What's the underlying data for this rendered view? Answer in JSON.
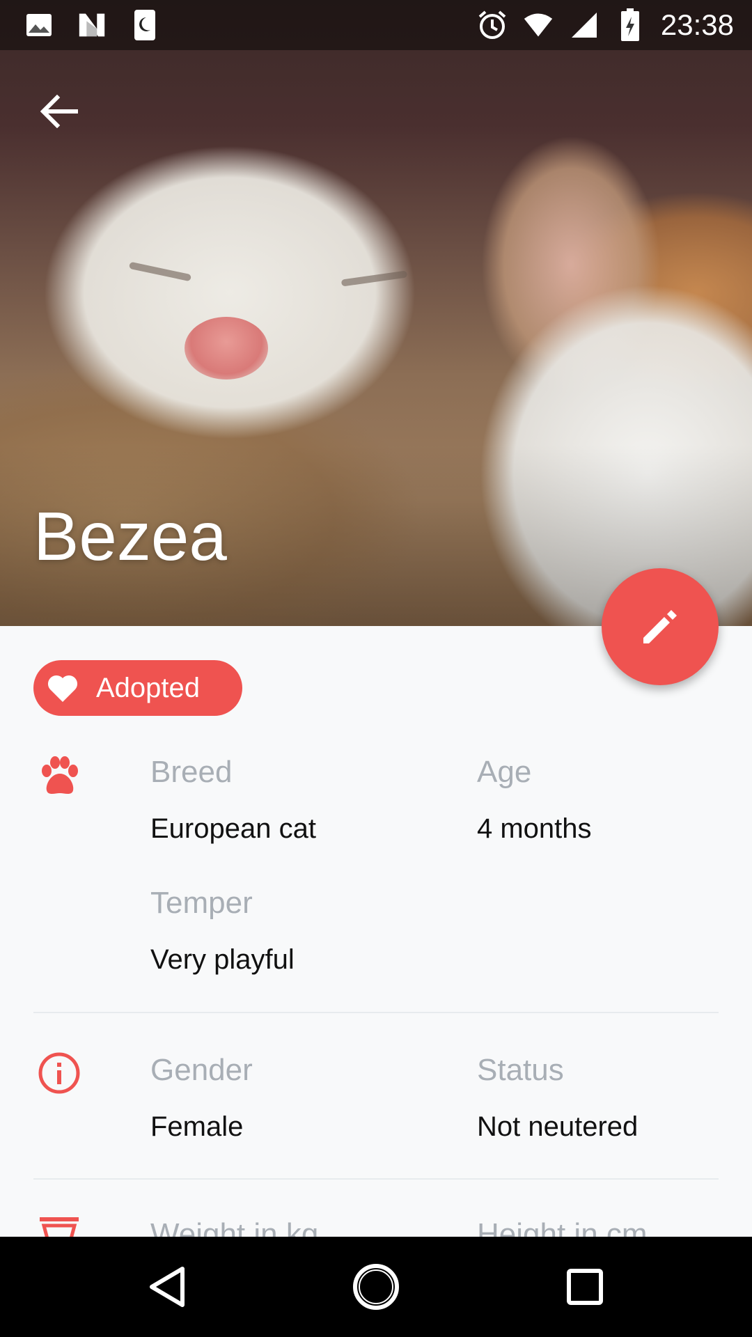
{
  "status_bar": {
    "time": "23:38",
    "left_icons": [
      "image-icon",
      "n-logo-icon",
      "moon-icon"
    ],
    "right_icons": [
      "alarm-icon",
      "wifi-icon",
      "signal-icon",
      "battery-charging-icon"
    ]
  },
  "header": {
    "pet_name": "Bezea"
  },
  "status_chip": {
    "label": "Adopted",
    "icon": "heart-icon"
  },
  "details": {
    "breed": {
      "label": "Breed",
      "value": "European cat"
    },
    "age": {
      "label": "Age",
      "value": "4 months"
    },
    "temper": {
      "label": "Temper",
      "value": "Very playful"
    },
    "gender": {
      "label": "Gender",
      "value": "Female"
    },
    "neuter_status": {
      "label": "Status",
      "value": "Not neutered"
    },
    "weight": {
      "label": "Weight in kg"
    },
    "height": {
      "label": "Height in cm"
    }
  },
  "colors": {
    "accent": "#ef5350",
    "label": "#a8aeb5",
    "value": "#111111",
    "background": "#f8f9fa"
  }
}
